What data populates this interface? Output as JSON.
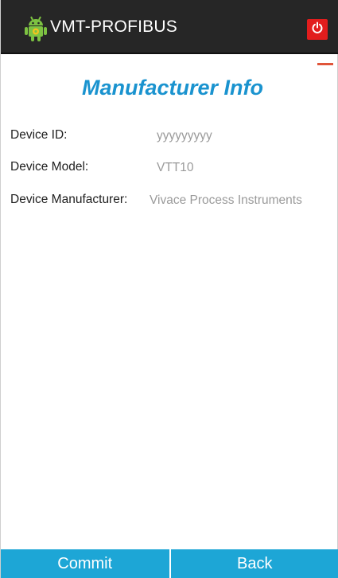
{
  "app": {
    "title": "VMT-PROFIBUS",
    "icon": "android-robot-icon",
    "power_icon": "power-icon",
    "power_color": "#e21d1d",
    "accent_color": "#1a93cf"
  },
  "page": {
    "title": "Manufacturer Info"
  },
  "fields": [
    {
      "label": "Device ID:",
      "value": "yyyyyyyyy"
    },
    {
      "label": "Device Model:",
      "value": "VTT10"
    },
    {
      "label": "Device Manufacturer:",
      "value": "Vivace Process Instruments"
    }
  ],
  "buttons": {
    "commit": "Commit",
    "back": "Back",
    "color": "#1da6d6"
  }
}
